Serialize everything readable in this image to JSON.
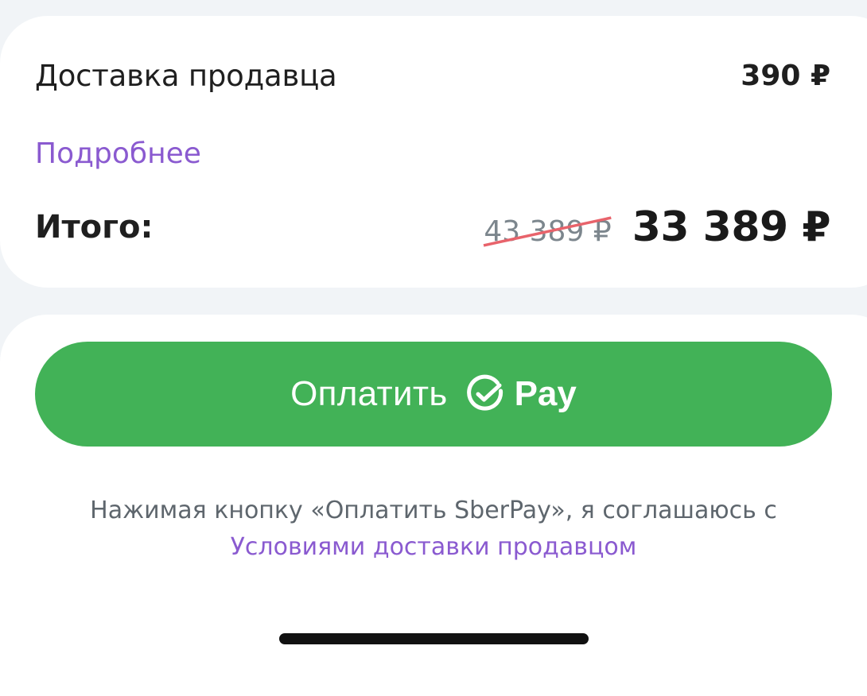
{
  "summary": {
    "delivery_label": "Доставка продавца",
    "delivery_price": "390 ₽",
    "more_link": "Подробнее",
    "total_label": "Итого:",
    "old_price": "43 389 ₽",
    "new_price": "33 389 ₽"
  },
  "payment": {
    "button_label": "Оплатить",
    "button_suffix": "Pay",
    "logo_icon": "sber-check-icon",
    "button_color": "#42b257"
  },
  "terms": {
    "text": "Нажимая кнопку «Оплатить SberPay», я соглашаюсь с",
    "link": "Условиями доставки продавцом"
  },
  "colors": {
    "accent_link": "#8a5ad0",
    "strike": "#e8636b"
  }
}
